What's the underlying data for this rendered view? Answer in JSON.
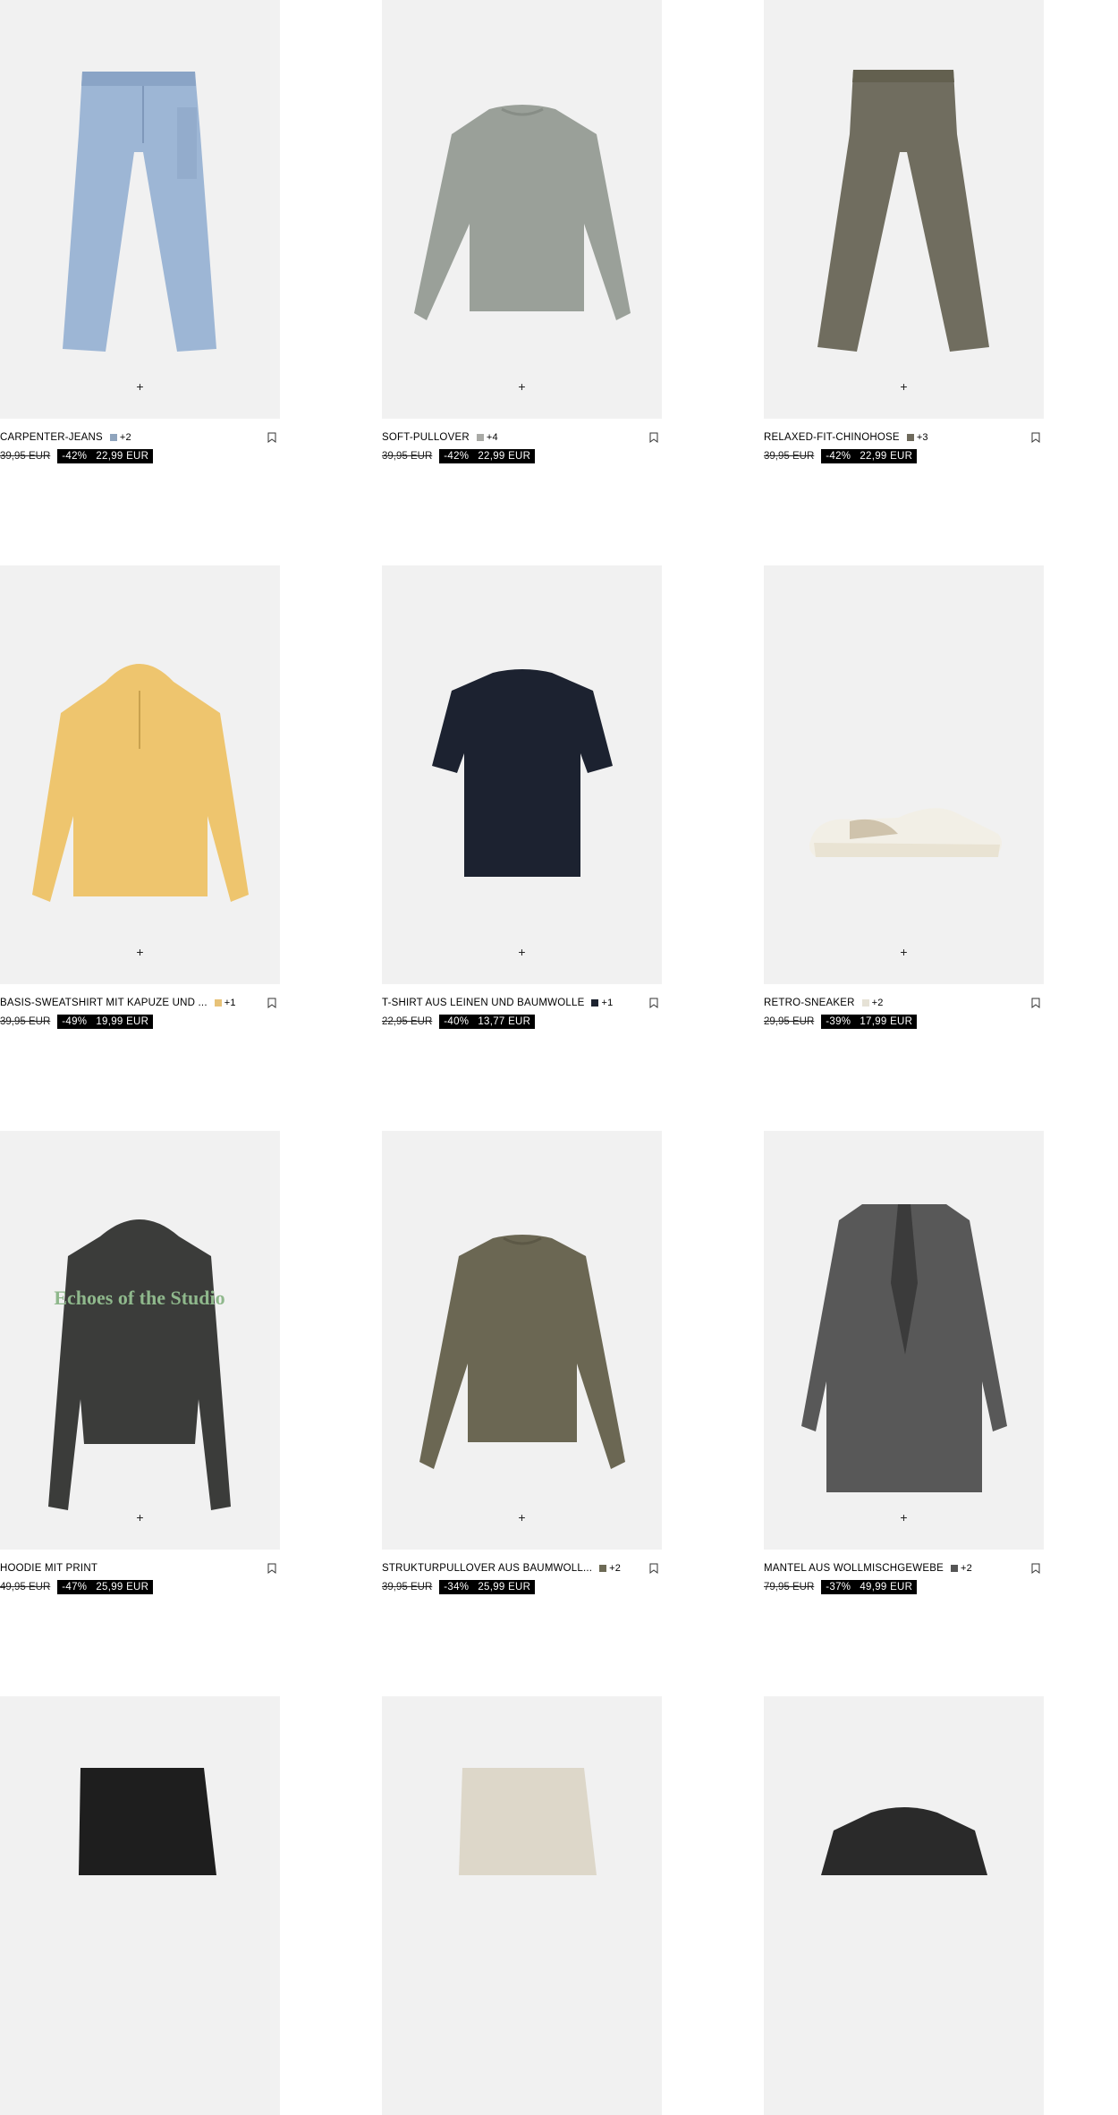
{
  "products": [
    {
      "name": "CARPENTER-JEANS",
      "swatch": "#8fa4bd",
      "more": "+2",
      "old_price": "39,95 EUR",
      "discount": "-42%",
      "price": "22,99 EUR",
      "icon": "jeans-icon"
    },
    {
      "name": "SOFT-PULLOVER",
      "swatch": "#a9aaa6",
      "more": "+4",
      "old_price": "39,95 EUR",
      "discount": "-42%",
      "price": "22,99 EUR",
      "icon": "sweater-icon"
    },
    {
      "name": "RELAXED-FIT-CHINOHOSE",
      "swatch": "#6e6a5c",
      "more": "+3",
      "old_price": "39,95 EUR",
      "discount": "-42%",
      "price": "22,99 EUR",
      "icon": "trousers-icon"
    },
    {
      "name": "BASIS-SWEATSHIRT MIT KAPUZE UND ...",
      "swatch": "#e7c278",
      "more": "+1",
      "old_price": "39,95 EUR",
      "discount": "-49%",
      "price": "19,99 EUR",
      "icon": "hoodie-icon"
    },
    {
      "name": "T-SHIRT AUS LEINEN UND BAUMWOLLE",
      "swatch": "#1d2330",
      "more": "+1",
      "old_price": "22,95 EUR",
      "discount": "-40%",
      "price": "13,77 EUR",
      "icon": "tshirt-icon"
    },
    {
      "name": "RETRO-SNEAKER",
      "swatch": "#e6e2d6",
      "more": "+2",
      "old_price": "29,95 EUR",
      "discount": "-39%",
      "price": "17,99 EUR",
      "icon": "sneaker-icon"
    },
    {
      "name": "HOODIE MIT PRINT",
      "swatch": "",
      "more": "",
      "old_price": "49,95 EUR",
      "discount": "-47%",
      "price": "25,99 EUR",
      "icon": "printed-hoodie-icon",
      "print_text": "Echoes of the Studio"
    },
    {
      "name": "STRUKTURPULLOVER AUS BAUMWOLL...",
      "swatch": "#6d6a55",
      "more": "+2",
      "old_price": "39,95 EUR",
      "discount": "-34%",
      "price": "25,99 EUR",
      "icon": "sweater-icon"
    },
    {
      "name": "MANTEL AUS WOLLMISCHGEWEBE",
      "swatch": "#555555",
      "more": "+2",
      "old_price": "79,95 EUR",
      "discount": "-37%",
      "price": "49,99 EUR",
      "icon": "coat-icon"
    },
    {
      "name": "",
      "icon": "shorts-icon"
    },
    {
      "name": "",
      "icon": "shorts-icon"
    },
    {
      "name": "",
      "icon": "sweater-icon"
    }
  ],
  "ui": {
    "quick_add_symbol": "+"
  }
}
